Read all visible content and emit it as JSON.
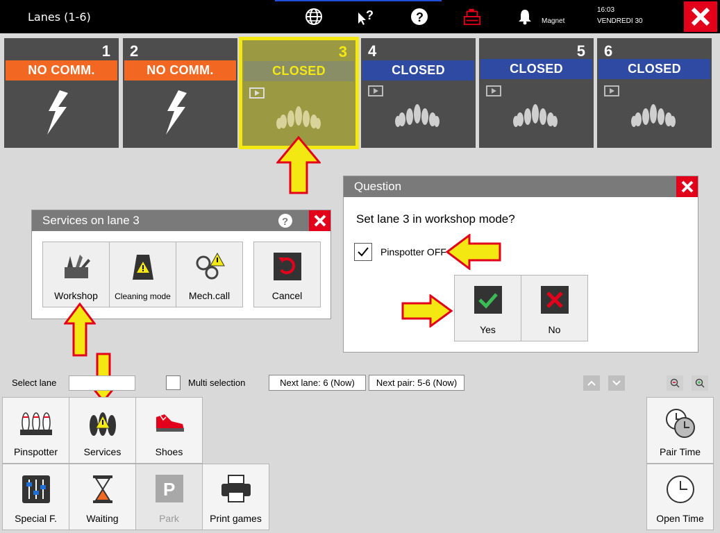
{
  "topbar": {
    "title": "Lanes (1-6)",
    "user": "Magnet",
    "time": "16:03",
    "date": "VENDREDI 30"
  },
  "lanes": [
    {
      "num": "1",
      "status": "NO COMM."
    },
    {
      "num": "2",
      "status": "NO COMM."
    },
    {
      "num": "3",
      "status": "CLOSED"
    },
    {
      "num": "4",
      "status": "CLOSED"
    },
    {
      "num": "5",
      "status": "CLOSED"
    },
    {
      "num": "6",
      "status": "CLOSED"
    }
  ],
  "colors": {
    "orange": "#f26722",
    "blue": "#2e4aa3",
    "red": "#e3001b",
    "yellow": "#f3e812"
  },
  "services_dialog": {
    "title": "Services on lane 3",
    "items": [
      "Workshop",
      "Cleaning mode",
      "Mech.call",
      "Cancel"
    ]
  },
  "question_dialog": {
    "title": "Question",
    "text": "Set lane 3 in workshop mode?",
    "checkbox_label": "Pinspotter OFF",
    "yes": "Yes",
    "no": "No"
  },
  "selectbar": {
    "select_lane": "Select lane",
    "multi": "Multi selection",
    "next_lane": "Next lane: 6 (Now)",
    "next_pair": "Next pair: 5-6 (Now)"
  },
  "menu": {
    "pinspotter": "Pinspotter",
    "services": "Services",
    "shoes": "Shoes",
    "special": "Special F.",
    "waiting": "Waiting",
    "park": "Park",
    "print": "Print games",
    "pair_time": "Pair Time",
    "open_time": "Open Time"
  }
}
